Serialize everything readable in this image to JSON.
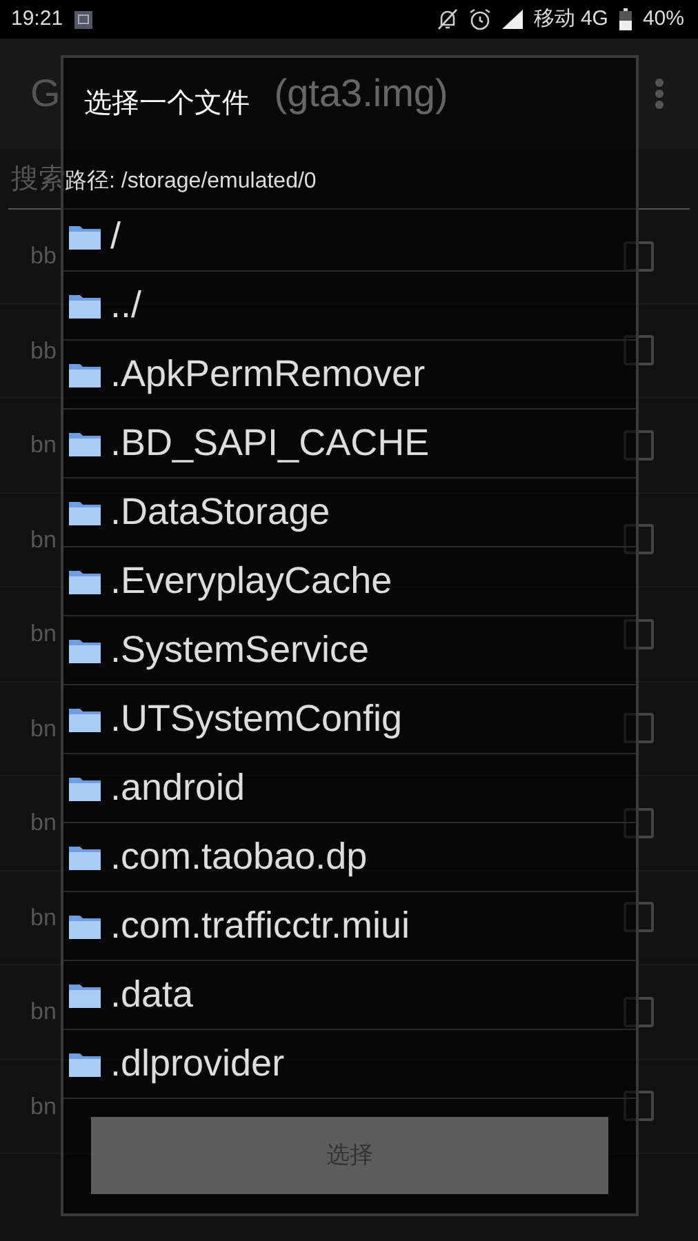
{
  "status_bar": {
    "time": "19:21",
    "carrier": "移动 4G",
    "battery_text": "40%"
  },
  "app": {
    "title": "G",
    "title_suffix": "(gta3.img)",
    "search": {
      "placeholder": "搜索"
    },
    "rows": [
      {
        "label": "bb",
        "checked": false
      },
      {
        "label": "bb",
        "checked": false
      },
      {
        "label": "bn",
        "checked": false
      },
      {
        "label": "bn",
        "checked": false
      },
      {
        "label": "bn",
        "checked": false
      },
      {
        "label": "bn",
        "checked": false
      },
      {
        "label": "bn",
        "checked": false
      },
      {
        "label": "bn",
        "checked": false
      },
      {
        "label": "bn",
        "checked": false
      },
      {
        "label": "bn",
        "checked": false
      }
    ]
  },
  "dialog": {
    "title": "选择一个文件",
    "path": "路径: /storage/emulated/0",
    "items": [
      {
        "name": "/",
        "kind": "folder"
      },
      {
        "name": "../",
        "kind": "folder"
      },
      {
        "name": ".ApkPermRemover",
        "kind": "folder"
      },
      {
        "name": ".BD_SAPI_CACHE",
        "kind": "folder"
      },
      {
        "name": ".DataStorage",
        "kind": "folder"
      },
      {
        "name": ".EveryplayCache",
        "kind": "folder"
      },
      {
        "name": ".SystemService",
        "kind": "folder"
      },
      {
        "name": ".UTSystemConfig",
        "kind": "folder"
      },
      {
        "name": ".android",
        "kind": "folder"
      },
      {
        "name": ".com.taobao.dp",
        "kind": "folder"
      },
      {
        "name": ".com.trafficctr.miui",
        "kind": "folder"
      },
      {
        "name": ".data",
        "kind": "folder"
      },
      {
        "name": ".dlprovider",
        "kind": "folder"
      }
    ],
    "button": {
      "label": "选择",
      "disabled": true
    }
  }
}
